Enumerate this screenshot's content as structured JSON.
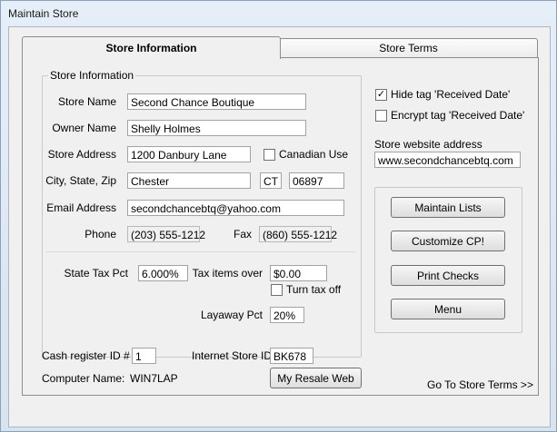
{
  "window": {
    "title": "Maintain Store"
  },
  "tabs": {
    "store_info": "Store Information",
    "store_terms": "Store Terms"
  },
  "store_info_group": {
    "legend": "Store Information",
    "store_name_label": "Store Name",
    "store_name": "Second Chance Boutique",
    "owner_name_label": "Owner Name",
    "owner_name": "Shelly Holmes",
    "store_address_label": "Store Address",
    "store_address": "1200 Danbury Lane",
    "canadian_use_label": "Canadian Use",
    "city_state_zip_label": "City, State, Zip",
    "city": "Chester",
    "state": "CT",
    "zip": "06897",
    "email_label": "Email Address",
    "email": "secondchancebtq@yahoo.com",
    "phone_label": "Phone",
    "phone": "(203) 555-1212",
    "fax_label": "Fax",
    "fax": "(860) 555-1212",
    "state_tax_label": "State Tax Pct",
    "state_tax": "6.000%",
    "tax_items_over_label": "Tax items over",
    "tax_items_over": "$0.00",
    "turn_tax_off_label": "Turn tax off",
    "layaway_label": "Layaway Pct",
    "layaway": "20%"
  },
  "options": {
    "hide_tag_label": "Hide tag 'Received Date'",
    "hide_tag_checked": true,
    "encrypt_tag_label": "Encrypt tag 'Received Date'",
    "encrypt_tag_checked": false,
    "website_label": "Store website address",
    "website": "www.secondchancebtq.com"
  },
  "actions": {
    "maintain_lists": "Maintain Lists",
    "customize_cp": "Customize CP!",
    "print_checks": "Print Checks",
    "menu": "Menu"
  },
  "footer": {
    "cash_register_label": "Cash register ID #",
    "cash_register_id": "1",
    "internet_store_label": "Internet Store ID",
    "internet_store_id": "BK678",
    "computer_name_label": "Computer Name:",
    "computer_name": "WIN7LAP",
    "my_resale_web": "My Resale Web",
    "go_to_terms": "Go To Store Terms >>"
  }
}
